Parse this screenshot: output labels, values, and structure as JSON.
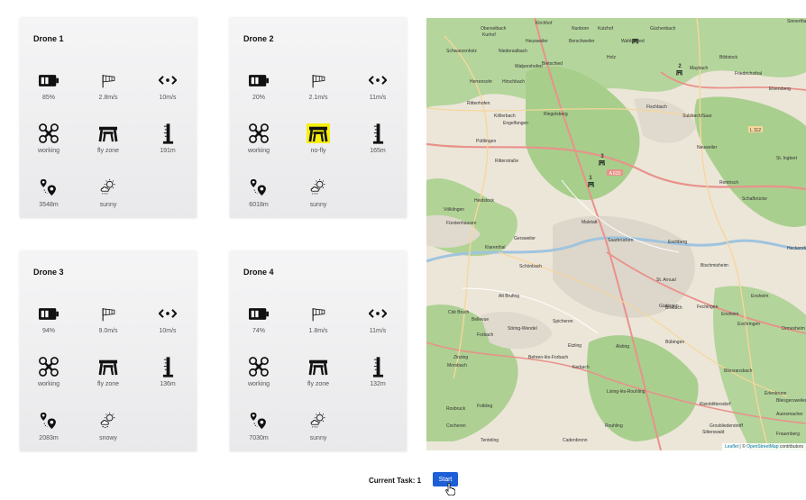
{
  "drones": [
    {
      "title": "Drone 1",
      "battery": "85%",
      "wind": "2.8m/s",
      "speed": "10m/s",
      "status": "working",
      "zone": "fly zone",
      "zone_highlight": false,
      "altitude": "191m",
      "distance": "3548m",
      "weather": "sunny"
    },
    {
      "title": "Drone 2",
      "battery": "20%",
      "wind": "2.1m/s",
      "speed": "11m/s",
      "status": "working",
      "zone": "no-fly",
      "zone_highlight": true,
      "altitude": "165m",
      "distance": "6018m",
      "weather": "sunny"
    },
    {
      "title": "Drone 3",
      "battery": "94%",
      "wind": "9.0m/s",
      "speed": "10m/s",
      "status": "working",
      "zone": "fly zone",
      "zone_highlight": false,
      "altitude": "136m",
      "distance": "2083m",
      "weather": "snowy"
    },
    {
      "title": "Drone 4",
      "battery": "74%",
      "wind": "1.8m/s",
      "speed": "11m/s",
      "status": "working",
      "zone": "fly zone",
      "zone_highlight": false,
      "altitude": "132m",
      "distance": "7030m",
      "weather": "sunny"
    }
  ],
  "icons": {
    "battery": "battery-icon",
    "wind": "windsock-icon",
    "speed": "speed-arrows-icon",
    "status": "drone-icon",
    "zone": "zone-gate-icon",
    "altitude": "altitude-ruler-icon",
    "distance": "distance-pins-icon",
    "weather": "weather-icon"
  },
  "map": {
    "places": [
      "Kirchhof",
      "Nunborn",
      "Kutzhof",
      "Sinnerthal",
      "Oberselbach",
      "Kurhof",
      "Heusweiler",
      "Berschweiler",
      "Wahlschied",
      "Güchenbach",
      "Holz",
      "Schwarzenholz",
      "Niedersalbach",
      "Walpershofen",
      "Bietschied",
      "Maybach",
      "Bildstock",
      "Herrensohr",
      "Riegelsberg",
      "Hirschbach",
      "Friedrichsthal",
      "Elversberg",
      "Rittenhofen",
      "Köllerbach",
      "Engelfangen",
      "Püttlingen",
      "Fischbach",
      "Sulzbach/Saar",
      "Neuweiler",
      "Ritterstraße",
      "St. Ingbert",
      "Rentrisch",
      "Heidstock",
      "Völklingen",
      "Malstatt",
      "Schafbrücke",
      "Fürstenhausen",
      "Klarenthal",
      "Gersweiler",
      "Saarbrücken",
      "Eschberg",
      "Ensheim",
      "Heckendalheim",
      "Schönbach",
      "St. Arnual",
      "Brebach",
      "Bischmisheim",
      "Alt Brufing",
      "Forbach",
      "Stiring-Wendel",
      "Spicheren",
      "Güdingen",
      "Fechingen",
      "Eschringen",
      "Ormesheim",
      "Morsbach",
      "Behren-lès-Forbach",
      "Kerbach",
      "Etzling",
      "Alsting",
      "Bübingen",
      "Bliesransbach",
      "Auersmacher",
      "Kleinblittersdorf",
      "Bliesgersweiler",
      "Folkling",
      "Lixing-lès-Rouhling",
      "Tenteling",
      "Cadenbronn",
      "Rouhling",
      "Sitterswald",
      "Frauenberg",
      "Rosbruck",
      "Cocheren",
      "Grosbliederstroff",
      "Erlenbrunn",
      "Bellevue",
      "Cité Bruch",
      "Zinzing",
      "Ensheim"
    ],
    "roads": [
      "A 620",
      "L 112"
    ],
    "markers": [
      "1",
      "2",
      "3"
    ],
    "attribution_leaflet": "Leaflet",
    "attribution_sep": " | © ",
    "attribution_osm": "OpenStreetMap",
    "attribution_rest": " contributors"
  },
  "footer": {
    "task_label": "Current Task: 1",
    "start_label": "Start"
  },
  "colors": {
    "accent": "#1c5fd6",
    "highlight": "#f7ef0d",
    "forest": "#a9cf8e",
    "urban": "#ddd6ca",
    "road_major": "#e8928a",
    "road_minor": "#f7d69c"
  }
}
